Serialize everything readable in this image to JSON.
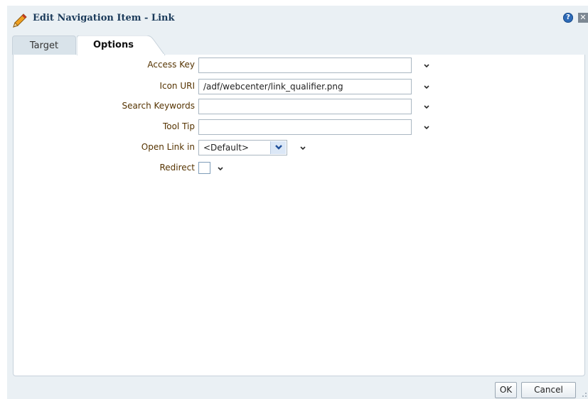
{
  "dialog": {
    "title": "Edit Navigation Item - Link",
    "help_icon": "help-icon",
    "close_icon": "close-icon",
    "help_glyph": "?",
    "close_glyph": "✕"
  },
  "tabs": [
    {
      "label": "Target",
      "selected": false
    },
    {
      "label": "Options",
      "selected": true
    }
  ],
  "form": {
    "access_key": {
      "label": "Access Key",
      "value": ""
    },
    "icon_uri": {
      "label": "Icon URI",
      "value": "/adf/webcenter/link_qualifier.png"
    },
    "search_keywords": {
      "label": "Search Keywords",
      "value": ""
    },
    "tool_tip": {
      "label": "Tool Tip",
      "value": ""
    },
    "open_link_in": {
      "label": "Open Link in",
      "value": "<Default>"
    },
    "redirect": {
      "label": "Redirect",
      "checked": false
    }
  },
  "footer": {
    "ok_label": "OK",
    "cancel_label": "Cancel"
  },
  "colors": {
    "label_text": "#553300",
    "title_text": "#1a3a5a",
    "dialog_background": "#eaf0f4"
  }
}
